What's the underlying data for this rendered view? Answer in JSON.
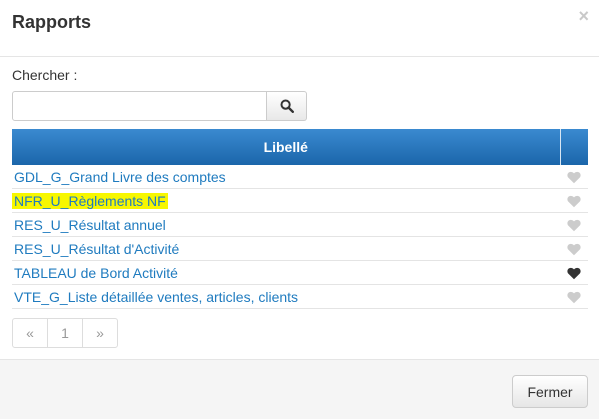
{
  "modal": {
    "title": "Rapports",
    "close_glyph": "×"
  },
  "search": {
    "label": "Chercher :",
    "value": "",
    "placeholder": "",
    "button_icon": "search-icon"
  },
  "table": {
    "header": "Libellé",
    "rows": [
      {
        "label": "GDL_G_Grand Livre des comptes",
        "favorite": false,
        "highlighted": false
      },
      {
        "label": "NFR_U_Règlements NF",
        "favorite": false,
        "highlighted": true
      },
      {
        "label": "RES_U_Résultat annuel",
        "favorite": false,
        "highlighted": false
      },
      {
        "label": "RES_U_Résultat d'Activité",
        "favorite": false,
        "highlighted": false
      },
      {
        "label": "TABLEAU de Bord Activité",
        "favorite": true,
        "highlighted": false
      },
      {
        "label": "VTE_G_Liste détaillée ventes, articles, clients",
        "favorite": false,
        "highlighted": false
      }
    ]
  },
  "pagination": {
    "prev": "«",
    "page": "1",
    "next": "»"
  },
  "footer": {
    "close_label": "Fermer"
  },
  "colors": {
    "header_bg": "#1b66aa",
    "link": "#1f7bbf",
    "highlight": "#f7f700",
    "heart_on": "#333333",
    "heart_off": "#cccccc"
  }
}
